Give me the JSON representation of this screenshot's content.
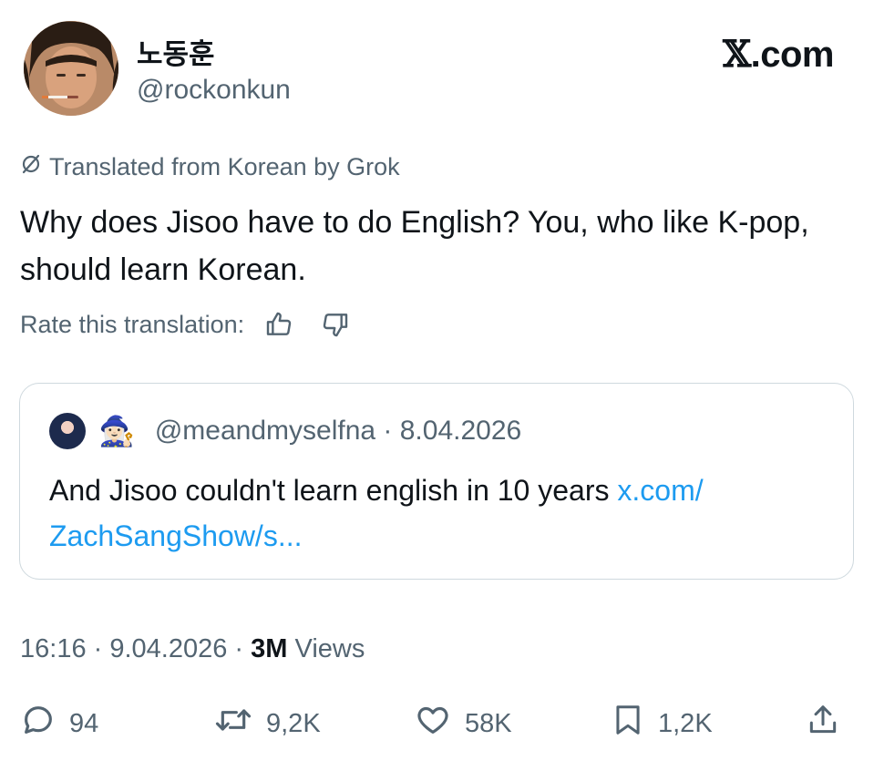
{
  "author": {
    "display_name": "노동훈",
    "handle": "@rockonkun"
  },
  "brand": {
    "x_letter": "𝕏",
    "domain": ".com"
  },
  "translation": {
    "notice": "Translated from Korean by Grok",
    "rate_label": "Rate this translation:"
  },
  "tweet": {
    "text": "Why does Jisoo have to do English? You, who like K-pop, should learn Korean."
  },
  "quote": {
    "emoji": "🧙🏻‍♀️",
    "handle": "@meandmyselfna",
    "separator": " · ",
    "date": "8.04.2026",
    "text": "And Jisoo couldn't learn english in 10 years ",
    "link": "x.com/ ZachSangShow/s..."
  },
  "meta": {
    "time": "16:16",
    "date": "9.04.2026",
    "views_count": "3M",
    "views_label": "Views"
  },
  "actions": {
    "replies": "94",
    "reposts": "9,2K",
    "likes": "58K",
    "bookmarks": "1,2K"
  },
  "colors": {
    "text": "#0f1419",
    "secondary": "#536471",
    "link": "#1d9bf0",
    "border": "#cfd9de"
  },
  "icons": [
    "translate-icon",
    "thumbs-up-icon",
    "thumbs-down-icon",
    "reply-icon",
    "repost-icon",
    "like-icon",
    "bookmark-icon",
    "share-icon"
  ]
}
